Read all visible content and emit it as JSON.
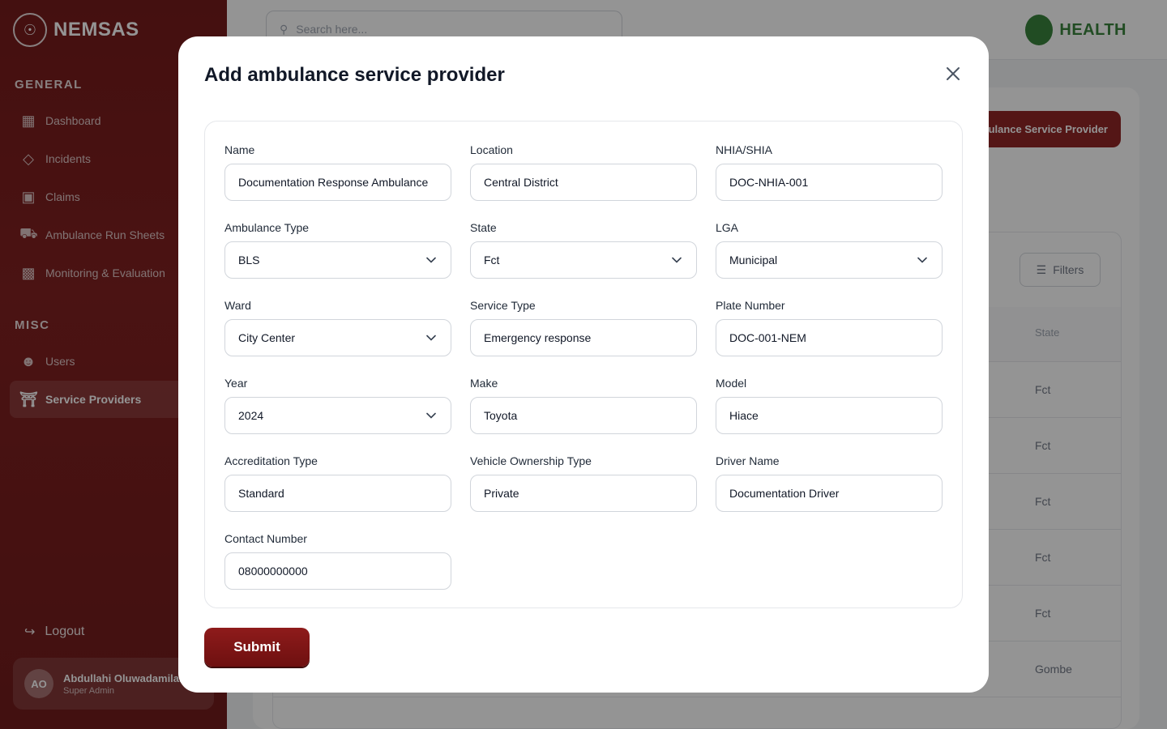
{
  "app": {
    "brand": "NEMSAS",
    "gov_logo_text": "HEALTH",
    "search_placeholder": "Search here...",
    "sections": {
      "general": "GENERAL",
      "misc": "MISC"
    },
    "nav": [
      {
        "label": "Dashboard",
        "icon": "grid-icon"
      },
      {
        "label": "Incidents",
        "icon": "diamond-icon"
      },
      {
        "label": "Claims",
        "icon": "clipboard-icon"
      },
      {
        "label": "Ambulance Run Sheets",
        "icon": "ambulance-icon"
      },
      {
        "label": "Monitoring & Evaluation",
        "icon": "bar-chart-icon"
      },
      {
        "label": "Users",
        "icon": "users-icon"
      },
      {
        "label": "Service Providers",
        "icon": "hospital-icon"
      }
    ],
    "logout": "Logout",
    "user": {
      "initials": "AO",
      "name": "Abdullahi Oluwadamilare",
      "role": "Super Admin"
    },
    "add_provider_button": "Add Ambulance Service Provider",
    "filters_button": "Filters",
    "table_header_state": "State",
    "table_states": [
      "Fct",
      "Fct",
      "Fct",
      "Fct",
      "Fct",
      "Gombe"
    ]
  },
  "modal": {
    "title": "Add ambulance service provider",
    "submit_label": "Submit",
    "fields": {
      "name": {
        "label": "Name",
        "value": "Documentation Response Ambulance"
      },
      "location": {
        "label": "Location",
        "value": "Central District"
      },
      "nhia": {
        "label": "NHIA/SHIA",
        "value": "DOC-NHIA-001"
      },
      "ambulance_type": {
        "label": "Ambulance Type",
        "value": "BLS"
      },
      "state": {
        "label": "State",
        "value": "Fct"
      },
      "lga": {
        "label": "LGA",
        "value": "Municipal"
      },
      "ward": {
        "label": "Ward",
        "value": "City Center"
      },
      "service_type": {
        "label": "Service Type",
        "value": "Emergency response"
      },
      "plate_number": {
        "label": "Plate Number",
        "value": "DOC-001-NEM"
      },
      "year": {
        "label": "Year",
        "value": "2024"
      },
      "make": {
        "label": "Make",
        "value": "Toyota"
      },
      "model": {
        "label": "Model",
        "value": "Hiace"
      },
      "accreditation_type": {
        "label": "Accreditation Type",
        "value": "Standard"
      },
      "ownership_type": {
        "label": "Vehicle Ownership Type",
        "value": "Private"
      },
      "driver_name": {
        "label": "Driver Name",
        "value": "Documentation Driver"
      },
      "contact_number": {
        "label": "Contact Number",
        "value": "08000000000"
      }
    }
  },
  "colors": {
    "primary": "#7a1414",
    "accent_green": "#2e7d32"
  }
}
